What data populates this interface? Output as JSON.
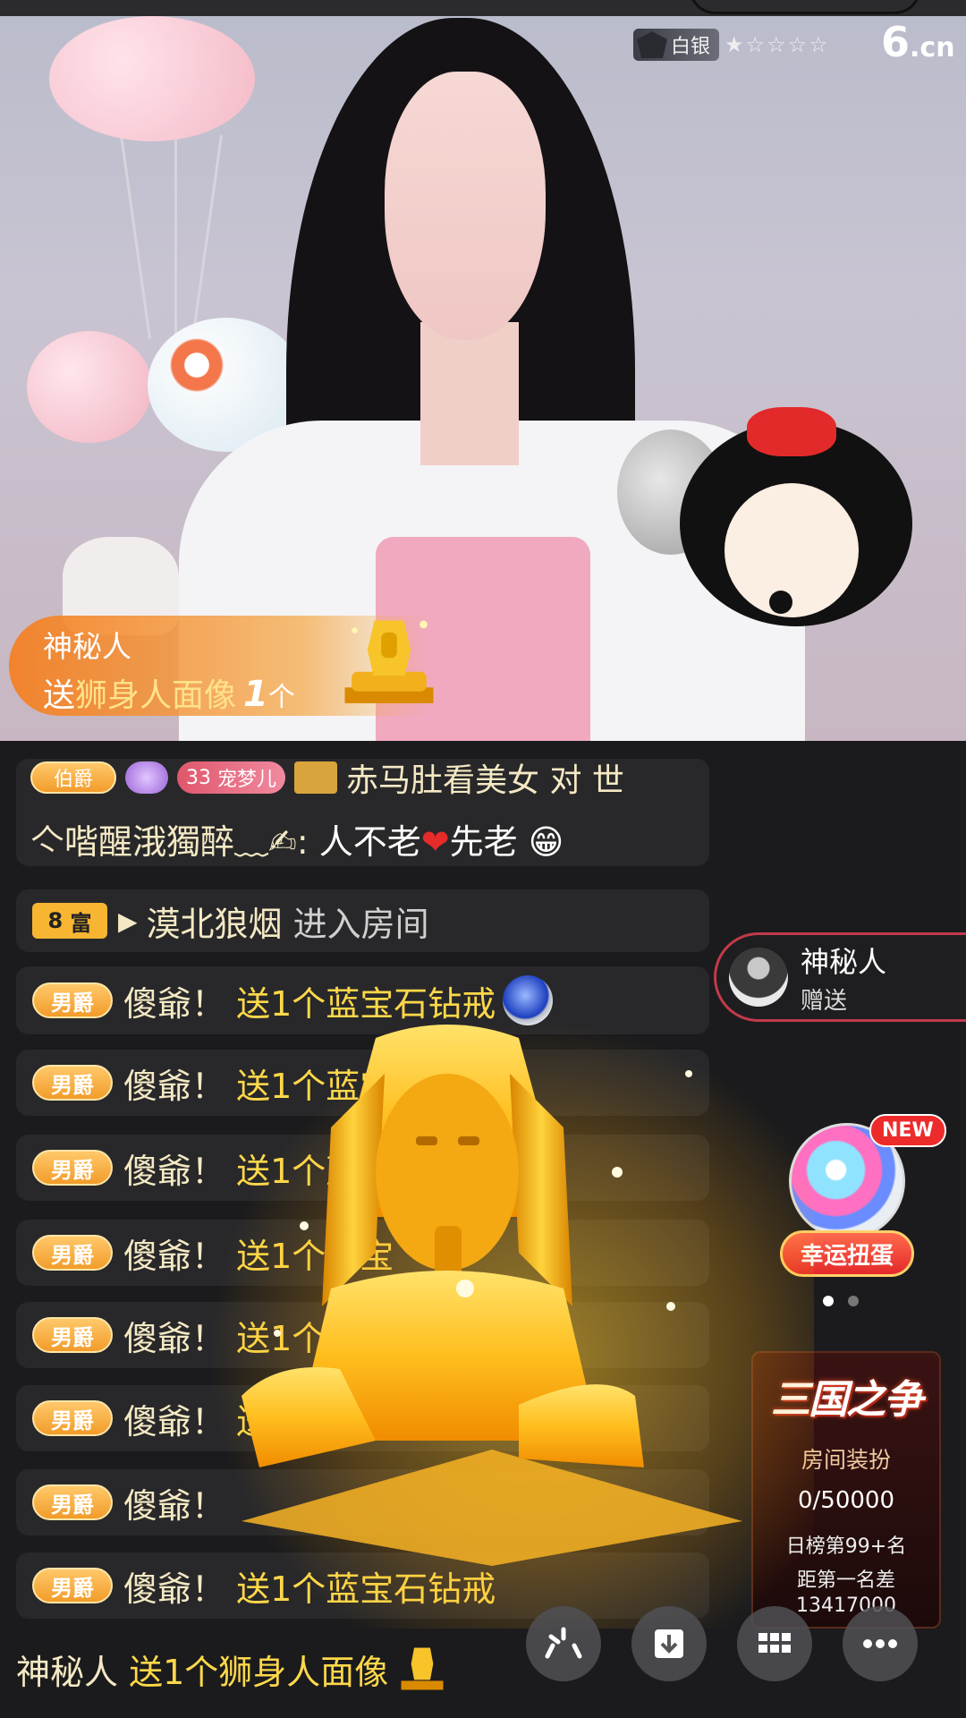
{
  "stream": {
    "rank_label": "白银",
    "stars": "★☆☆☆☆",
    "logo": "6",
    "logo_suffix": ".cn"
  },
  "gift_banner": {
    "sender": "神秘人",
    "verb": "送",
    "gift_name": "狮身人面像",
    "count": "1",
    "unit": "个"
  },
  "chat": {
    "top_message": {
      "noble_badge": "伯爵",
      "level": "33",
      "fan_badge": "宠梦儿",
      "line1_text": "赤马肚看美女 对 世",
      "user": "亽喈醒涐獨醉﹏✍:",
      "msg_a": "人不老",
      "heart": "❤",
      "msg_b": "先老",
      "emoji": "😁"
    },
    "enter_row": {
      "badge_num": "8",
      "badge_label": "富",
      "arrow": "▶",
      "user": "漠北狼烟",
      "action": "进入房间"
    },
    "gift_rows": [
      {
        "badge": "男爵",
        "user": "傻爺！",
        "text": "送1个蓝宝石钻戒"
      },
      {
        "badge": "男爵",
        "user": "傻爺！",
        "text": "送1个蓝宝"
      },
      {
        "badge": "男爵",
        "user": "傻爺！",
        "text": "送1个蓝宝"
      },
      {
        "badge": "男爵",
        "user": "傻爺！",
        "text": "送1个蓝宝"
      },
      {
        "badge": "男爵",
        "user": "傻爺！",
        "text": "送1个蓝"
      },
      {
        "badge": "男爵",
        "user": "傻爺！",
        "text": "送1个"
      },
      {
        "badge": "男爵",
        "user": "傻爺！",
        "text": ""
      },
      {
        "badge": "男爵",
        "user": "傻爺！",
        "text": "送1个蓝宝石钻戒"
      }
    ],
    "bottom_message": {
      "user": "神秘人",
      "text": "送1个狮身人面像"
    }
  },
  "sender_card": {
    "name": "神秘人",
    "action": "赠送"
  },
  "gacha": {
    "new_label": "NEW",
    "label": "幸运扭蛋"
  },
  "event": {
    "title": "三国之争",
    "subtitle": "房间装扮",
    "progress": "0/50000",
    "rank": "日榜第99+名",
    "gap_label": "距第一名差",
    "gap_value": "13417000"
  },
  "toolbar": {
    "btn1_icon": "sparkle-icon",
    "btn2_icon": "download-icon",
    "btn3_icon": "grid-icon",
    "btn4_icon": "more-icon"
  }
}
